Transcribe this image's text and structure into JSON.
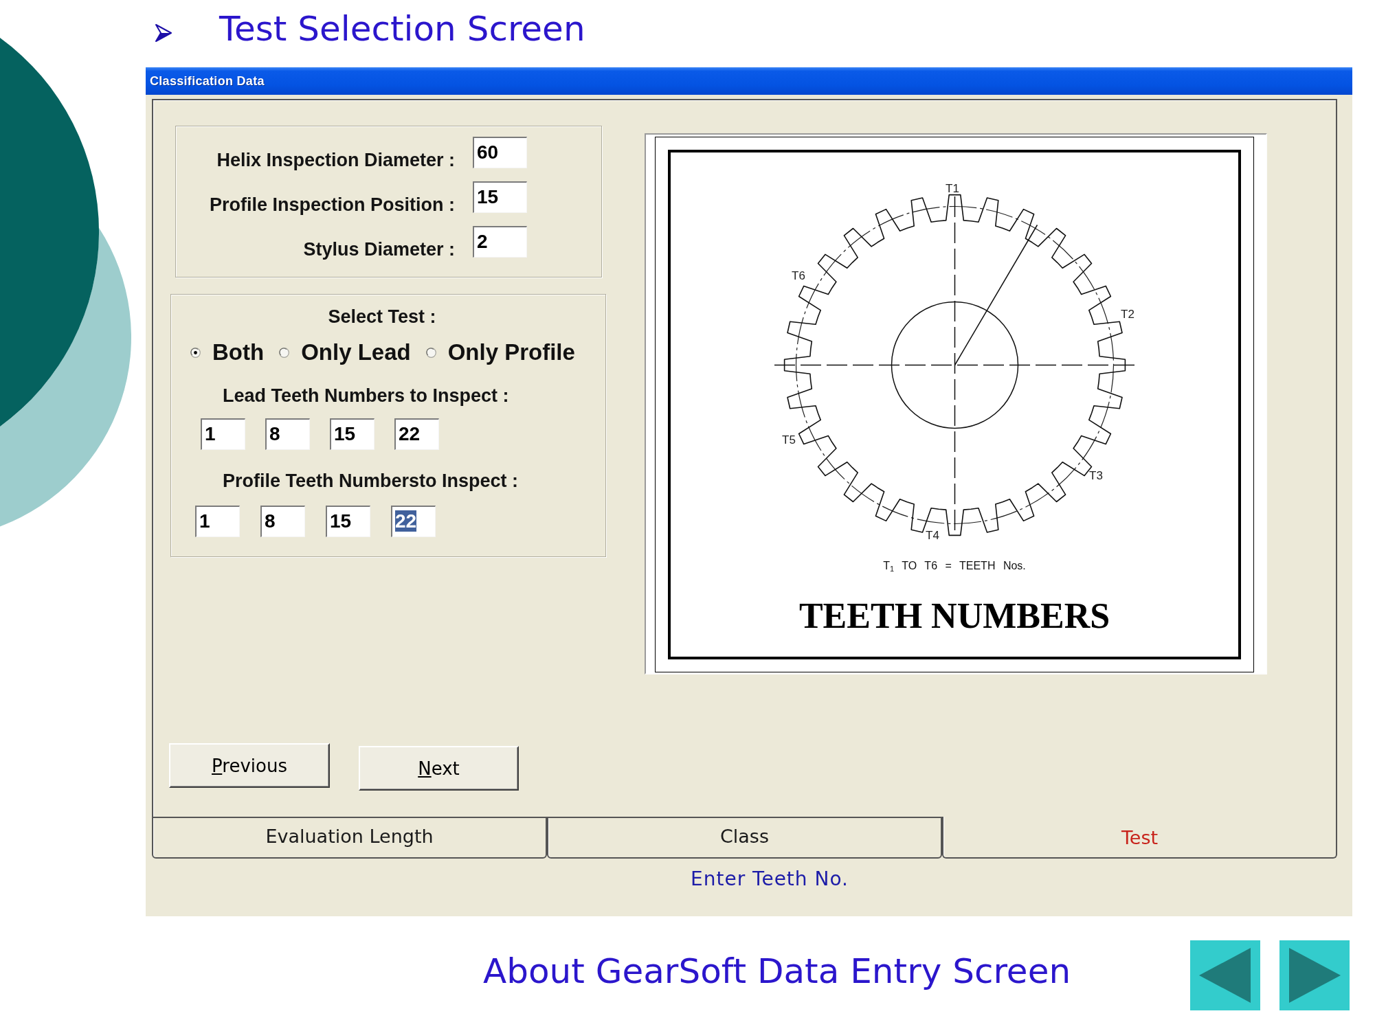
{
  "slide_title": "Test Selection Screen",
  "window": {
    "title": "Classification Data"
  },
  "inspection": [
    {
      "label": "Helix Inspection Diameter :",
      "value": "60"
    },
    {
      "label": "Profile Inspection Position :",
      "value": "15"
    },
    {
      "label": "Stylus Diameter :",
      "value": "2"
    }
  ],
  "select_test": {
    "label": "Select Test :",
    "options": [
      {
        "label": "Both",
        "selected": true
      },
      {
        "label": "Only Lead",
        "selected": false
      },
      {
        "label": "Only Profile",
        "selected": false
      }
    ]
  },
  "lead_teeth": {
    "label": "Lead Teeth Numbers to Inspect :",
    "fields": [
      {
        "value": "1",
        "text_selected": false
      },
      {
        "value": "8",
        "text_selected": false
      },
      {
        "value": "15",
        "text_selected": false
      },
      {
        "value": "22",
        "text_selected": false
      }
    ]
  },
  "profile_teeth": {
    "label": "Profile Teeth Numbersto Inspect :",
    "fields": [
      {
        "value": "1",
        "text_selected": false
      },
      {
        "value": "8",
        "text_selected": false
      },
      {
        "value": "15",
        "text_selected": false
      },
      {
        "value": "22",
        "text_selected": true
      }
    ]
  },
  "diagram": {
    "tooth_labels": [
      "T1",
      "T2",
      "T3",
      "T4",
      "T5",
      "T6"
    ],
    "legend": "T$_{1}$ TO T6 = TEETH Nos.",
    "title": "TEETH NUMBERS"
  },
  "buttons": [
    {
      "label": "Previous",
      "mnemonic_underlined": true
    },
    {
      "label": "Next",
      "mnemonic_underlined": true
    }
  ],
  "tabs": [
    {
      "label": "Evaluation Length",
      "selected": false
    },
    {
      "label": "Class",
      "selected": false
    },
    {
      "label": "Test",
      "selected": true
    }
  ],
  "status": "Enter Teeth No.",
  "footer": "About GearSoft Data Entry Screen"
}
